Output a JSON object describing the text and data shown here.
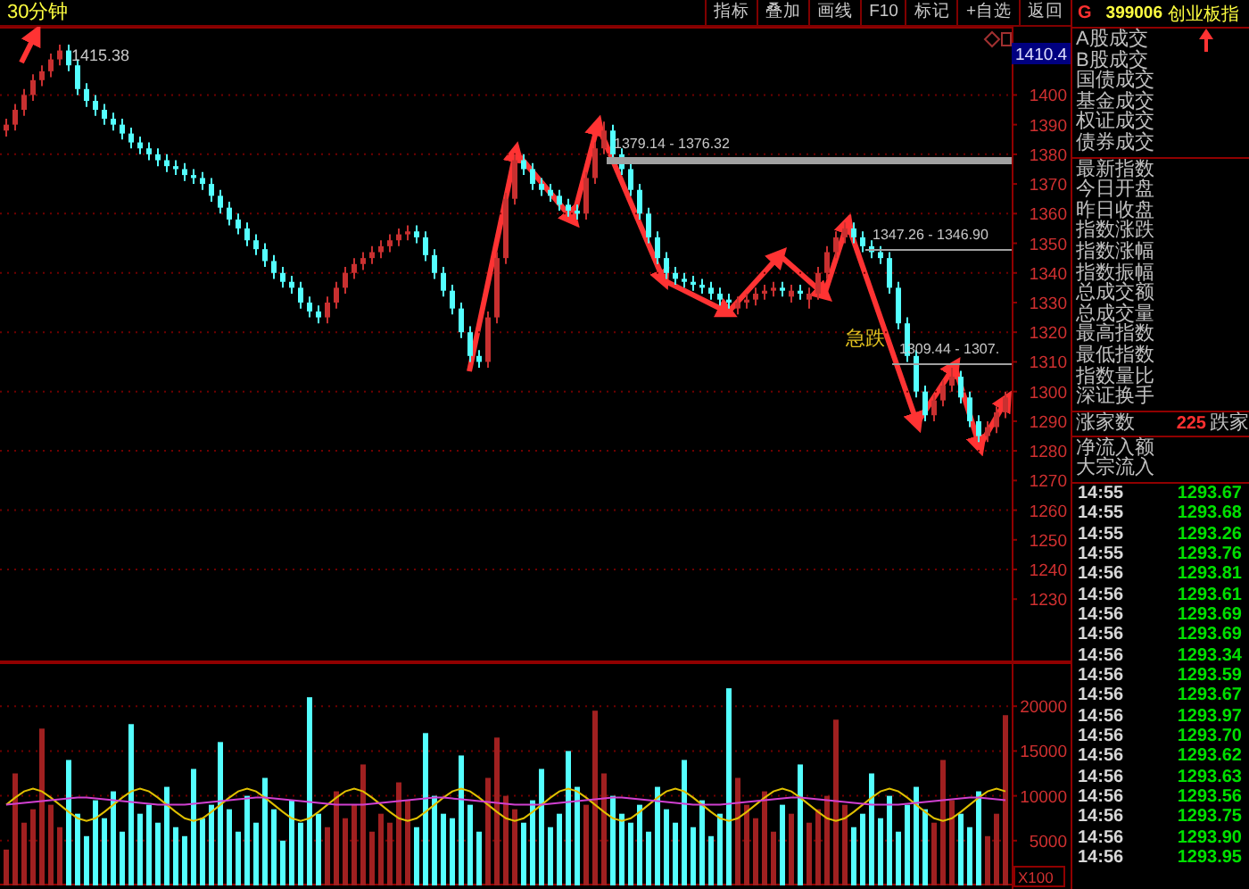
{
  "header": {
    "period": "30分钟",
    "toolbar": [
      "指标",
      "叠加",
      "画线",
      "F10",
      "标记",
      "+自选",
      "返回"
    ]
  },
  "chart": {
    "last_price": "1410.4",
    "high_label": "1415.38",
    "levels": [
      {
        "label": "1379.14 - 1376.32",
        "kind": "thick"
      },
      {
        "label": "1347.26 - 1346.90",
        "kind": "thin"
      },
      {
        "label": "1309.44 - 1307.",
        "kind": "thin"
      }
    ],
    "note": "急跌",
    "chart_data": {
      "type": "candlestick",
      "grid": true,
      "ylim": [
        1209,
        1423
      ],
      "yticks": [
        1400,
        1390,
        1380,
        1370,
        1360,
        1350,
        1340,
        1330,
        1320,
        1310,
        1300,
        1290,
        1280,
        1270,
        1260,
        1250,
        1240,
        1230
      ],
      "ohlc": [
        [
          1388,
          1392,
          1386,
          1390
        ],
        [
          1390,
          1397,
          1388,
          1395
        ],
        [
          1395,
          1402,
          1393,
          1400
        ],
        [
          1400,
          1407,
          1398,
          1405
        ],
        [
          1405,
          1410,
          1403,
          1408
        ],
        [
          1408,
          1414,
          1406,
          1412
        ],
        [
          1412,
          1417,
          1410,
          1415
        ],
        [
          1415,
          1417,
          1408,
          1410
        ],
        [
          1410,
          1412,
          1400,
          1402
        ],
        [
          1402,
          1404,
          1396,
          1398
        ],
        [
          1398,
          1400,
          1393,
          1395
        ],
        [
          1395,
          1397,
          1390,
          1392
        ],
        [
          1392,
          1394,
          1388,
          1390
        ],
        [
          1390,
          1392,
          1385,
          1387
        ],
        [
          1387,
          1389,
          1382,
          1384
        ],
        [
          1384,
          1386,
          1380,
          1382
        ],
        [
          1382,
          1384,
          1378,
          1380
        ],
        [
          1380,
          1382,
          1376,
          1378
        ],
        [
          1378,
          1380,
          1374,
          1376
        ],
        [
          1376,
          1378,
          1373,
          1375
        ],
        [
          1375,
          1377,
          1371,
          1373
        ],
        [
          1373,
          1375,
          1370,
          1372
        ],
        [
          1372,
          1374,
          1368,
          1370
        ],
        [
          1370,
          1372,
          1364,
          1366
        ],
        [
          1366,
          1368,
          1360,
          1362
        ],
        [
          1362,
          1364,
          1356,
          1358
        ],
        [
          1358,
          1360,
          1353,
          1355
        ],
        [
          1355,
          1357,
          1349,
          1351
        ],
        [
          1351,
          1353,
          1346,
          1348
        ],
        [
          1348,
          1350,
          1342,
          1344
        ],
        [
          1344,
          1346,
          1338,
          1340
        ],
        [
          1340,
          1342,
          1335,
          1337
        ],
        [
          1337,
          1339,
          1333,
          1335
        ],
        [
          1335,
          1337,
          1328,
          1330
        ],
        [
          1330,
          1332,
          1325,
          1327
        ],
        [
          1327,
          1329,
          1323,
          1325
        ],
        [
          1325,
          1332,
          1323,
          1330
        ],
        [
          1330,
          1337,
          1328,
          1335
        ],
        [
          1335,
          1342,
          1333,
          1340
        ],
        [
          1340,
          1345,
          1338,
          1343
        ],
        [
          1343,
          1347,
          1341,
          1345
        ],
        [
          1345,
          1349,
          1343,
          1347
        ],
        [
          1347,
          1351,
          1345,
          1349
        ],
        [
          1349,
          1353,
          1347,
          1351
        ],
        [
          1351,
          1355,
          1349,
          1353
        ],
        [
          1353,
          1356,
          1351,
          1354
        ],
        [
          1354,
          1356,
          1350,
          1352
        ],
        [
          1352,
          1354,
          1344,
          1346
        ],
        [
          1346,
          1348,
          1338,
          1340
        ],
        [
          1340,
          1342,
          1332,
          1334
        ],
        [
          1334,
          1336,
          1326,
          1328
        ],
        [
          1328,
          1330,
          1318,
          1320
        ],
        [
          1320,
          1322,
          1310,
          1312
        ],
        [
          1312,
          1314,
          1308,
          1310
        ],
        [
          1310,
          1327,
          1308,
          1325
        ],
        [
          1325,
          1347,
          1323,
          1345
        ],
        [
          1345,
          1367,
          1343,
          1365
        ],
        [
          1365,
          1380,
          1363,
          1378
        ],
        [
          1378,
          1380,
          1373,
          1375
        ],
        [
          1375,
          1377,
          1368,
          1370
        ],
        [
          1370,
          1372,
          1366,
          1368
        ],
        [
          1368,
          1370,
          1364,
          1366
        ],
        [
          1366,
          1368,
          1361,
          1363
        ],
        [
          1363,
          1365,
          1359,
          1361
        ],
        [
          1361,
          1363,
          1358,
          1360
        ],
        [
          1360,
          1374,
          1358,
          1372
        ],
        [
          1372,
          1384,
          1370,
          1382
        ],
        [
          1382,
          1391,
          1380,
          1388
        ],
        [
          1388,
          1390,
          1378,
          1380
        ],
        [
          1380,
          1382,
          1373,
          1375
        ],
        [
          1375,
          1377,
          1366,
          1368
        ],
        [
          1368,
          1370,
          1358,
          1360
        ],
        [
          1360,
          1362,
          1350,
          1352
        ],
        [
          1352,
          1354,
          1343,
          1345
        ],
        [
          1345,
          1347,
          1338,
          1340
        ],
        [
          1340,
          1342,
          1336,
          1338
        ],
        [
          1338,
          1340,
          1335,
          1337
        ],
        [
          1337,
          1339,
          1334,
          1336
        ],
        [
          1336,
          1338,
          1333,
          1335
        ],
        [
          1335,
          1337,
          1331,
          1333
        ],
        [
          1333,
          1335,
          1329,
          1331
        ],
        [
          1331,
          1333,
          1328,
          1330
        ],
        [
          1328,
          1332,
          1326,
          1330
        ],
        [
          1330,
          1333,
          1328,
          1331
        ],
        [
          1331,
          1335,
          1329,
          1333
        ],
        [
          1333,
          1336,
          1331,
          1334
        ],
        [
          1334,
          1337,
          1332,
          1335
        ],
        [
          1335,
          1337,
          1332,
          1334
        ],
        [
          1332,
          1336,
          1330,
          1334
        ],
        [
          1334,
          1336,
          1331,
          1333
        ],
        [
          1331,
          1335,
          1328,
          1333
        ],
        [
          1333,
          1342,
          1331,
          1340
        ],
        [
          1340,
          1349,
          1338,
          1347
        ],
        [
          1347,
          1354,
          1345,
          1352
        ],
        [
          1352,
          1357,
          1350,
          1355
        ],
        [
          1355,
          1357,
          1350,
          1352
        ],
        [
          1352,
          1354,
          1347,
          1349
        ],
        [
          1349,
          1351,
          1345,
          1347
        ],
        [
          1347,
          1349,
          1343,
          1345
        ],
        [
          1345,
          1347,
          1333,
          1335
        ],
        [
          1335,
          1337,
          1321,
          1323
        ],
        [
          1323,
          1325,
          1310,
          1312
        ],
        [
          1312,
          1314,
          1298,
          1300
        ],
        [
          1300,
          1302,
          1290,
          1292
        ],
        [
          1292,
          1299,
          1290,
          1297
        ],
        [
          1297,
          1304,
          1295,
          1302
        ],
        [
          1302,
          1308,
          1300,
          1305
        ],
        [
          1305,
          1307,
          1296,
          1298
        ],
        [
          1298,
          1300,
          1288,
          1290
        ],
        [
          1290,
          1292,
          1283,
          1285
        ],
        [
          1285,
          1290,
          1283,
          1288
        ],
        [
          1288,
          1295,
          1286,
          1293
        ],
        [
          1293,
          1300,
          1291,
          1298
        ]
      ]
    },
    "volume": {
      "unit": "X100",
      "chart_data": {
        "type": "bar",
        "grid": true,
        "ylim": [
          0,
          25000
        ],
        "yticks": [
          20000,
          15000,
          10000,
          5000
        ],
        "series": [
          {
            "type": "line",
            "color": "#e0c000",
            "values": [
              9000,
              9800,
              10500,
              10800,
              10500,
              9800,
              9000,
              8200,
              7500,
              7200,
              7500,
              8200,
              9000,
              9800,
              10500,
              10800,
              10500,
              9800,
              9000,
              8200,
              7500,
              7200,
              7500,
              8200,
              9000,
              9800,
              10500,
              10800,
              10500,
              9800,
              9000,
              8200,
              7500,
              7200,
              7500,
              8200,
              9000,
              9800,
              10500,
              10800,
              10500,
              9800,
              9000,
              8200,
              7500,
              7200,
              7500,
              8200,
              9000,
              9800,
              10500,
              10800,
              10500,
              9800,
              9000,
              8200,
              7500,
              7200,
              7500,
              8200,
              9000,
              9800,
              10500,
              10800,
              10500,
              9800,
              9000,
              8200,
              7500,
              7200,
              7500,
              8200,
              9000,
              9800,
              10500,
              10800,
              10500,
              9800,
              9000,
              8200,
              7500,
              7200,
              7500,
              8200,
              9000,
              9800,
              10500,
              10800,
              10500,
              9800,
              9000,
              8200,
              7500,
              7200,
              7500,
              8200,
              9000,
              9800,
              10500,
              10800,
              10500,
              9800,
              9000,
              8200,
              7500,
              7200,
              7500,
              8200,
              9000,
              9800,
              10500,
              10800,
              10500
            ]
          },
          {
            "type": "line",
            "color": "#d040d0",
            "values": [
              9000,
              9100,
              9200,
              9300,
              9400,
              9500,
              9600,
              9700,
              9800,
              9800,
              9700,
              9600,
              9500,
              9400,
              9300,
              9200,
              9100,
              9000,
              9000,
              9000,
              9000,
              9100,
              9200,
              9300,
              9400,
              9500,
              9600,
              9700,
              9800,
              9800,
              9700,
              9600,
              9500,
              9400,
              9300,
              9200,
              9100,
              9000,
              9000,
              9000,
              9000,
              9100,
              9200,
              9300,
              9400,
              9500,
              9600,
              9700,
              9800,
              9800,
              9700,
              9600,
              9500,
              9400,
              9300,
              9200,
              9100,
              9000,
              9000,
              9000,
              9000,
              9100,
              9200,
              9300,
              9400,
              9500,
              9600,
              9700,
              9800,
              9800,
              9700,
              9600,
              9500,
              9400,
              9300,
              9200,
              9100,
              9000,
              9000,
              9000,
              9000,
              9100,
              9200,
              9300,
              9400,
              9500,
              9600,
              9700,
              9800,
              9800,
              9700,
              9600,
              9500,
              9400,
              9300,
              9200,
              9100,
              9000,
              9000,
              9000,
              9000,
              9100,
              9200,
              9300,
              9400,
              9500,
              9600,
              9700,
              9800,
              9800,
              9700,
              9600,
              9500
            ]
          }
        ],
        "colors": [
          "#a02020",
          "#a02020",
          "#a02020",
          "#a02020",
          "#a02020",
          "#a02020",
          "#a02020",
          "#54ffff",
          "#54ffff",
          "#54ffff",
          "#54ffff",
          "#54ffff",
          "#54ffff",
          "#54ffff",
          "#54ffff",
          "#54ffff",
          "#54ffff",
          "#54ffff",
          "#54ffff",
          "#54ffff",
          "#54ffff",
          "#54ffff",
          "#54ffff",
          "#54ffff",
          "#54ffff",
          "#54ffff",
          "#54ffff",
          "#54ffff",
          "#54ffff",
          "#54ffff",
          "#54ffff",
          "#54ffff",
          "#54ffff",
          "#54ffff",
          "#54ffff",
          "#54ffff",
          "#a02020",
          "#a02020",
          "#a02020",
          "#a02020",
          "#a02020",
          "#a02020",
          "#a02020",
          "#a02020",
          "#a02020",
          "#a02020",
          "#54ffff",
          "#54ffff",
          "#54ffff",
          "#54ffff",
          "#54ffff",
          "#54ffff",
          "#54ffff",
          "#54ffff",
          "#a02020",
          "#a02020",
          "#a02020",
          "#a02020",
          "#54ffff",
          "#54ffff",
          "#54ffff",
          "#54ffff",
          "#54ffff",
          "#54ffff",
          "#54ffff",
          "#a02020",
          "#a02020",
          "#a02020",
          "#54ffff",
          "#54ffff",
          "#54ffff",
          "#54ffff",
          "#54ffff",
          "#54ffff",
          "#54ffff",
          "#54ffff",
          "#54ffff",
          "#54ffff",
          "#54ffff",
          "#54ffff",
          "#54ffff",
          "#54ffff",
          "#a02020",
          "#a02020",
          "#a02020",
          "#a02020",
          "#a02020",
          "#54ffff",
          "#a02020",
          "#54ffff",
          "#a02020",
          "#a02020",
          "#a02020",
          "#a02020",
          "#a02020",
          "#54ffff",
          "#54ffff",
          "#54ffff",
          "#54ffff",
          "#54ffff",
          "#54ffff",
          "#54ffff",
          "#54ffff",
          "#54ffff",
          "#a02020",
          "#a02020",
          "#a02020",
          "#54ffff",
          "#54ffff",
          "#54ffff",
          "#a02020",
          "#a02020",
          "#a02020"
        ],
        "values": [
          4000,
          12500,
          7000,
          8500,
          17500,
          9000,
          6500,
          14000,
          8000,
          5500,
          9500,
          7500,
          10500,
          6000,
          18000,
          8000,
          9000,
          7000,
          11000,
          6500,
          5500,
          13000,
          7500,
          9000,
          16000,
          8500,
          6000,
          10000,
          7000,
          12000,
          8500,
          5000,
          9500,
          7000,
          21000,
          8000,
          6500,
          10500,
          7500,
          9000,
          13500,
          6000,
          8000,
          7000,
          11500,
          9500,
          6500,
          17000,
          10000,
          8000,
          7500,
          14500,
          9000,
          6000,
          12000,
          16500,
          10000,
          8500,
          7000,
          9500,
          13000,
          6500,
          8000,
          15000,
          11000,
          9000,
          19500,
          12500,
          10000,
          8000,
          7000,
          9000,
          6000,
          11000,
          8500,
          7000,
          14000,
          6500,
          9500,
          5500,
          8000,
          22000,
          12000,
          9000,
          7500,
          10500,
          6000,
          9000,
          8000,
          13500,
          7000,
          8500,
          10000,
          18500,
          9000,
          6500,
          8000,
          12500,
          7500,
          10000,
          6000,
          9000,
          11000,
          8500,
          7000,
          14000,
          9500,
          8000,
          6500,
          10500,
          5500,
          8000,
          19000
        ]
      }
    }
  },
  "quote": {
    "prefix": "G",
    "code": "399006",
    "name": "创业板指",
    "sections": [
      [
        "A股成交",
        "B股成交",
        "国债成交",
        "基金成交",
        "权证成交",
        "债券成交"
      ],
      [
        "最新指数",
        "今日开盘",
        "昨日收盘",
        "指数涨跌",
        "指数涨幅",
        "指数振幅",
        "总成交额",
        "总成交量",
        "最高指数",
        "最低指数",
        "指数量比",
        "深证换手"
      ]
    ],
    "breadth": {
      "up_label": "涨家数",
      "up_count": "225",
      "down_label": "跌家"
    },
    "flows": [
      "净流入额",
      "大宗流入"
    ],
    "ticks": [
      {
        "time": "14:55",
        "price": "1293.67"
      },
      {
        "time": "14:55",
        "price": "1293.68"
      },
      {
        "time": "14:55",
        "price": "1293.26"
      },
      {
        "time": "14:55",
        "price": "1293.76"
      },
      {
        "time": "14:56",
        "price": "1293.81"
      },
      {
        "time": "14:56",
        "price": "1293.61"
      },
      {
        "time": "14:56",
        "price": "1293.69"
      },
      {
        "time": "14:56",
        "price": "1293.69"
      },
      {
        "time": "14:56",
        "price": "1293.34"
      },
      {
        "time": "14:56",
        "price": "1293.59"
      },
      {
        "time": "14:56",
        "price": "1293.67"
      },
      {
        "time": "14:56",
        "price": "1293.97"
      },
      {
        "time": "14:56",
        "price": "1293.70"
      },
      {
        "time": "14:56",
        "price": "1293.62"
      },
      {
        "time": "14:56",
        "price": "1293.63"
      },
      {
        "time": "14:56",
        "price": "1293.56"
      },
      {
        "time": "14:56",
        "price": "1293.75"
      },
      {
        "time": "14:56",
        "price": "1293.90"
      },
      {
        "time": "14:56",
        "price": "1293.95"
      }
    ]
  }
}
